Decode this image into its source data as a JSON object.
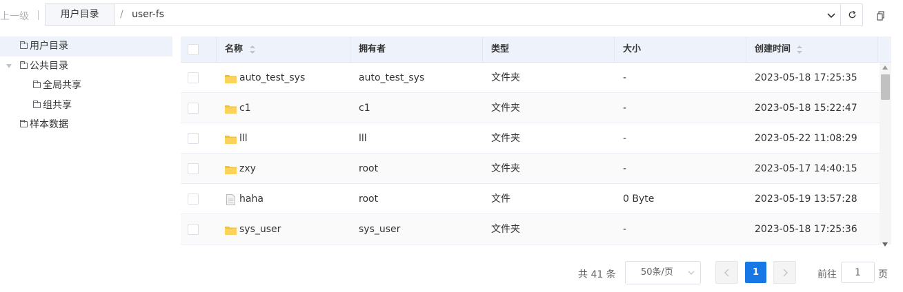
{
  "topbar": {
    "up_label": "上一级",
    "root_label": "用户目录",
    "separator": "/",
    "current_segment": "user-fs"
  },
  "sidebar": {
    "items": [
      {
        "label": "用户目录",
        "active": true
      },
      {
        "label": "公共目录",
        "expanded": true
      },
      {
        "label": "全局共享"
      },
      {
        "label": "组共享"
      },
      {
        "label": "样本数据"
      }
    ]
  },
  "table": {
    "headers": {
      "name": "名称",
      "owner": "拥有者",
      "type": "类型",
      "size": "大小",
      "created": "创建时间"
    },
    "rows": [
      {
        "icon": "folder-icon",
        "name": "auto_test_sys",
        "owner": "auto_test_sys",
        "type": "文件夹",
        "size": "-",
        "created": "2023-05-18 17:25:35"
      },
      {
        "icon": "folder-icon",
        "name": "c1",
        "owner": "c1",
        "type": "文件夹",
        "size": "-",
        "created": "2023-05-18 15:22:47"
      },
      {
        "icon": "folder-icon",
        "name": "lll",
        "owner": "lll",
        "type": "文件夹",
        "size": "-",
        "created": "2023-05-22 11:08:29"
      },
      {
        "icon": "folder-icon",
        "name": "zxy",
        "owner": "root",
        "type": "文件夹",
        "size": "-",
        "created": "2023-05-17 14:40:15"
      },
      {
        "icon": "file-icon",
        "name": "haha",
        "owner": "root",
        "type": "文件",
        "size": "0 Byte",
        "created": "2023-05-19 13:57:28"
      },
      {
        "icon": "folder-icon",
        "name": "sys_user",
        "owner": "sys_user",
        "type": "文件夹",
        "size": "-",
        "created": "2023-05-18 17:25:36"
      }
    ]
  },
  "pagination": {
    "total_text": "共 41 条",
    "page_size": "50条/页",
    "current_page": "1",
    "goto_label": "前往",
    "goto_value": "1",
    "page_suffix": "页"
  },
  "colors": {
    "accent": "#1677e5",
    "header_bg": "#eef2fa",
    "folder": "#f7c12f"
  }
}
